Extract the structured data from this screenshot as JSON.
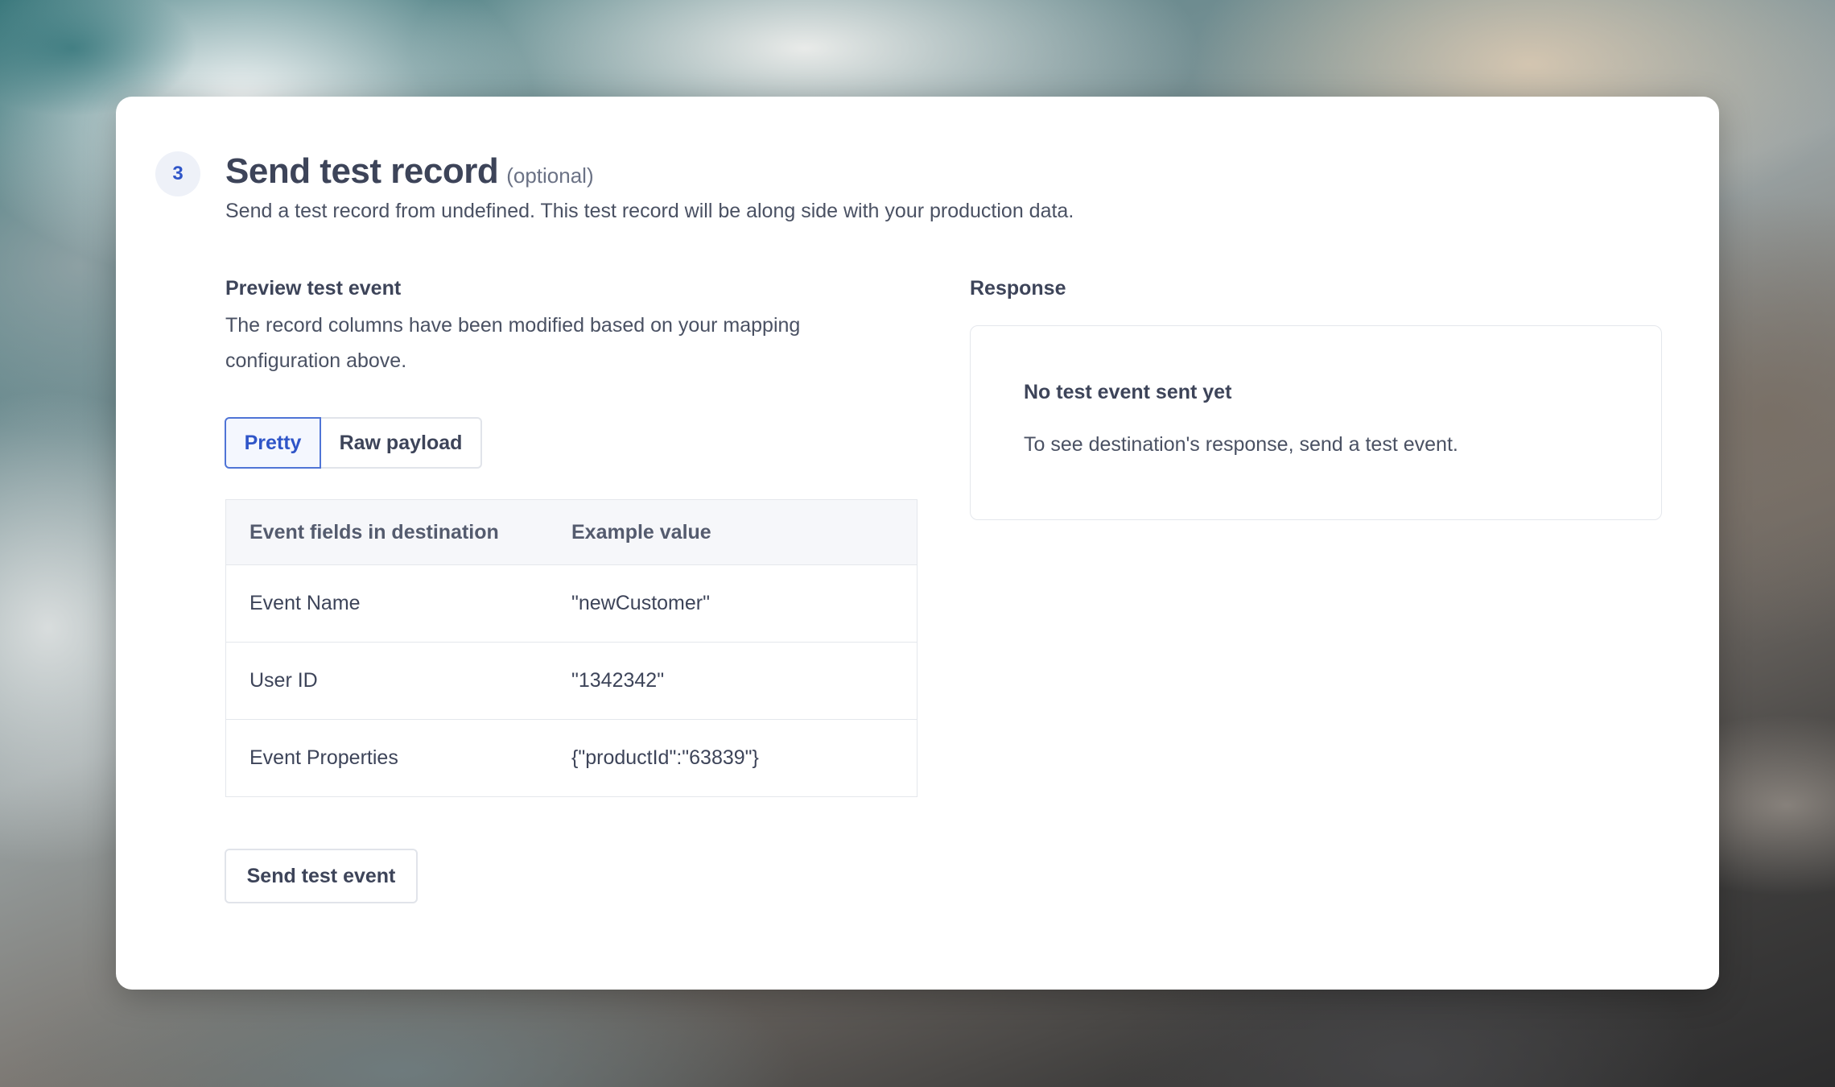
{
  "step": {
    "number": "3",
    "title": "Send test record",
    "optional_label": "(optional)",
    "subtitle": "Send a test record from undefined. This test record will be along side with your production data."
  },
  "preview": {
    "label": "Preview test event",
    "description": "The record columns have been modified based on your mapping configuration above.",
    "tabs": [
      {
        "label": "Pretty",
        "active": true
      },
      {
        "label": "Raw payload",
        "active": false
      }
    ],
    "table": {
      "headers": [
        "Event fields in destination",
        "Example value"
      ],
      "rows": [
        {
          "field": "Event Name",
          "value": "\"newCustomer\""
        },
        {
          "field": "User ID",
          "value": "\"1342342\""
        },
        {
          "field": "Event Properties",
          "value": "{\"productId\":\"63839\"}"
        }
      ]
    },
    "send_button_label": "Send test event"
  },
  "response": {
    "label": "Response",
    "empty_title": "No test event sent yet",
    "empty_text": "To see destination's response, send a test event."
  },
  "colors": {
    "accent": "#2f55c8",
    "text_primary": "#3d4459",
    "border": "#e4e7ec"
  }
}
